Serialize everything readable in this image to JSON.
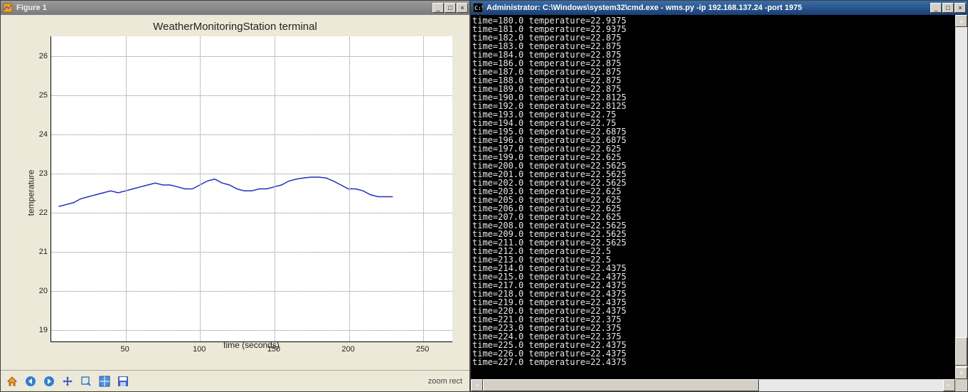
{
  "figure_window": {
    "title": "Figure 1",
    "toolbar_status": "zoom rect",
    "toolbar": {
      "home": "home-icon",
      "back": "back-icon",
      "forward": "forward-icon",
      "pan": "pan-icon",
      "zoom": "zoom-icon",
      "subplot": "subplot-icon",
      "save": "save-icon"
    }
  },
  "terminal_window": {
    "title": "Administrator: C:\\Windows\\system32\\cmd.exe - wms.py  -ip 192.168.137.24 -port 1975"
  },
  "chart_data": {
    "type": "line",
    "title": "WeatherMonitoringStation terminal",
    "xlabel": "time (seconds)",
    "ylabel": "temperature",
    "xlim": [
      0,
      270
    ],
    "ylim": [
      18.7,
      26.5
    ],
    "xticks": [
      50,
      100,
      150,
      200,
      250
    ],
    "yticks": [
      19,
      20,
      21,
      22,
      23,
      24,
      25,
      26
    ],
    "x": [
      5,
      10,
      15,
      20,
      25,
      30,
      35,
      40,
      45,
      50,
      55,
      60,
      65,
      70,
      75,
      80,
      85,
      90,
      95,
      100,
      105,
      110,
      115,
      120,
      125,
      130,
      135,
      140,
      145,
      150,
      155,
      160,
      165,
      170,
      175,
      180,
      185,
      190,
      195,
      200,
      205,
      210,
      215,
      220,
      225,
      230
    ],
    "y": [
      22.15,
      22.2,
      22.25,
      22.35,
      22.4,
      22.45,
      22.5,
      22.55,
      22.5,
      22.55,
      22.6,
      22.65,
      22.7,
      22.75,
      22.7,
      22.7,
      22.65,
      22.6,
      22.6,
      22.7,
      22.8,
      22.85,
      22.75,
      22.7,
      22.6,
      22.55,
      22.55,
      22.6,
      22.6,
      22.65,
      22.7,
      22.8,
      22.85,
      22.88,
      22.9,
      22.9,
      22.88,
      22.8,
      22.7,
      22.6,
      22.6,
      22.55,
      22.45,
      22.4,
      22.4,
      22.4
    ]
  },
  "terminal_log": [
    {
      "time": "180.0",
      "temp": "22.9375"
    },
    {
      "time": "181.0",
      "temp": "22.9375"
    },
    {
      "time": "182.0",
      "temp": "22.875"
    },
    {
      "time": "183.0",
      "temp": "22.875"
    },
    {
      "time": "184.0",
      "temp": "22.875"
    },
    {
      "time": "186.0",
      "temp": "22.875"
    },
    {
      "time": "187.0",
      "temp": "22.875"
    },
    {
      "time": "188.0",
      "temp": "22.875"
    },
    {
      "time": "189.0",
      "temp": "22.875"
    },
    {
      "time": "190.0",
      "temp": "22.8125"
    },
    {
      "time": "192.0",
      "temp": "22.8125"
    },
    {
      "time": "193.0",
      "temp": "22.75"
    },
    {
      "time": "194.0",
      "temp": "22.75"
    },
    {
      "time": "195.0",
      "temp": "22.6875"
    },
    {
      "time": "196.0",
      "temp": "22.6875"
    },
    {
      "time": "197.0",
      "temp": "22.625"
    },
    {
      "time": "199.0",
      "temp": "22.625"
    },
    {
      "time": "200.0",
      "temp": "22.5625"
    },
    {
      "time": "201.0",
      "temp": "22.5625"
    },
    {
      "time": "202.0",
      "temp": "22.5625"
    },
    {
      "time": "203.0",
      "temp": "22.625"
    },
    {
      "time": "205.0",
      "temp": "22.625"
    },
    {
      "time": "206.0",
      "temp": "22.625"
    },
    {
      "time": "207.0",
      "temp": "22.625"
    },
    {
      "time": "208.0",
      "temp": "22.5625"
    },
    {
      "time": "209.0",
      "temp": "22.5625"
    },
    {
      "time": "211.0",
      "temp": "22.5625"
    },
    {
      "time": "212.0",
      "temp": "22.5"
    },
    {
      "time": "213.0",
      "temp": "22.5"
    },
    {
      "time": "214.0",
      "temp": "22.4375"
    },
    {
      "time": "215.0",
      "temp": "22.4375"
    },
    {
      "time": "217.0",
      "temp": "22.4375"
    },
    {
      "time": "218.0",
      "temp": "22.4375"
    },
    {
      "time": "219.0",
      "temp": "22.4375"
    },
    {
      "time": "220.0",
      "temp": "22.4375"
    },
    {
      "time": "221.0",
      "temp": "22.375"
    },
    {
      "time": "223.0",
      "temp": "22.375"
    },
    {
      "time": "224.0",
      "temp": "22.375"
    },
    {
      "time": "225.0",
      "temp": "22.4375"
    },
    {
      "time": "226.0",
      "temp": "22.4375"
    },
    {
      "time": "227.0",
      "temp": "22.4375"
    }
  ]
}
